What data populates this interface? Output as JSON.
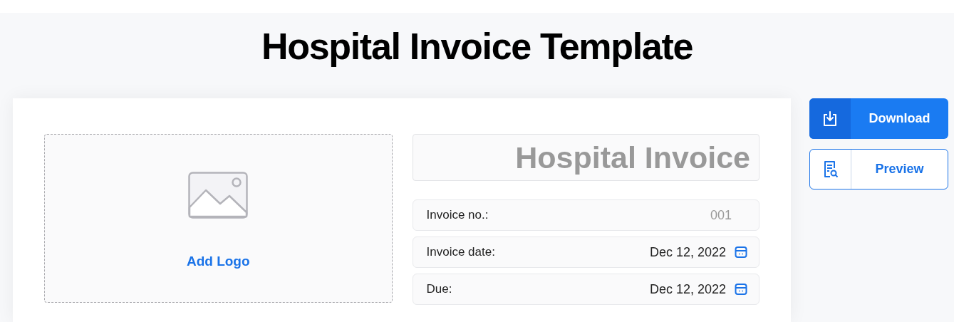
{
  "page_title": "Hospital Invoice Template",
  "logo": {
    "label": "Add Logo"
  },
  "invoice_title": {
    "placeholder": "Hospital Invoice"
  },
  "fields": [
    {
      "kind": "text",
      "label": "Invoice no.:",
      "placeholder": "001"
    },
    {
      "kind": "date",
      "label": "Invoice date:",
      "value": "Dec 12, 2022"
    },
    {
      "kind": "date",
      "label": "Due:",
      "value": "Dec 12, 2022"
    }
  ],
  "actions": [
    {
      "kind": "download",
      "label": "Download"
    },
    {
      "kind": "preview",
      "label": "Preview"
    }
  ]
}
